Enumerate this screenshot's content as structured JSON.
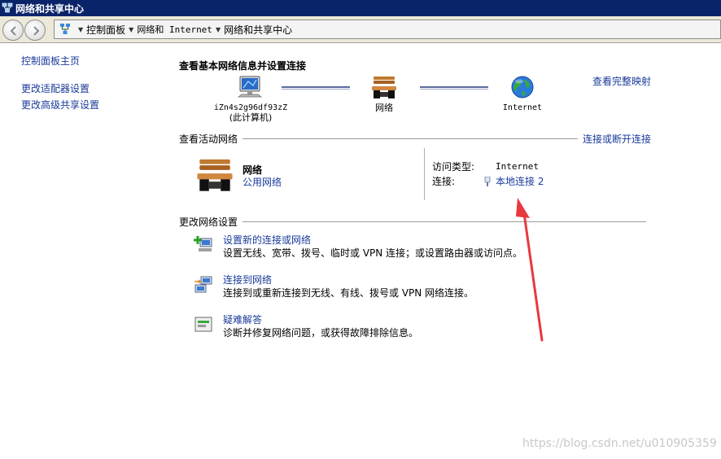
{
  "window": {
    "title": "网络和共享中心"
  },
  "addressbar": {
    "crumbs": [
      "控制面板",
      "网络和 Internet",
      "网络和共享中心"
    ]
  },
  "sidebar": {
    "items": [
      {
        "label": "控制面板主页"
      },
      {
        "label": "更改适配器设置"
      },
      {
        "label": "更改高级共享设置"
      }
    ]
  },
  "main": {
    "title": "查看基本网络信息并设置连接",
    "full_map_link": "查看完整映射",
    "nodes": {
      "computer_name": "iZn4s2g96df93zZ",
      "computer_sub": "(此计算机)",
      "network": "网络",
      "internet": "Internet"
    },
    "active_section": {
      "title": "查看活动网络",
      "link": "连接或断开连接",
      "network_name": "网络",
      "network_type": "公用网络",
      "access_type_label": "访问类型:",
      "access_type_value": "Internet",
      "connection_label": "连接:",
      "connection_value": "本地连接 2"
    },
    "settings_section": {
      "title": "更改网络设置",
      "tasks": [
        {
          "label": "设置新的连接或网络",
          "desc": "设置无线、宽带、拨号、临时或 VPN 连接；或设置路由器或访问点。",
          "icon": "new-connection-icon"
        },
        {
          "label": "连接到网络",
          "desc": "连接到或重新连接到无线、有线、拨号或 VPN 网络连接。",
          "icon": "connect-network-icon"
        },
        {
          "label": "疑难解答",
          "desc": "诊断并修复网络问题，或获得故障排除信息。",
          "icon": "troubleshoot-icon"
        }
      ]
    }
  },
  "watermark": "https://blog.csdn.net/u010905359",
  "colors": {
    "link": "#1a3a9a",
    "titlebar": "#0a246a",
    "annotation": "#e8383d"
  }
}
